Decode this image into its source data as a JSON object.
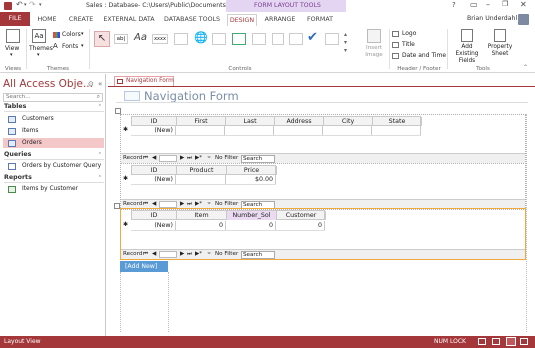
{
  "window": {
    "title": "Sales : Database- C:\\Users\\Public\\Documents\\Sa...",
    "context_tab_group": "FORM LAYOUT TOOLS",
    "help": "?",
    "user": "Brian Underdahl"
  },
  "ribbon_tabs": [
    "FILE",
    "HOME",
    "CREATE",
    "EXTERNAL DATA",
    "DATABASE TOOLS",
    "DESIGN",
    "ARRANGE",
    "FORMAT"
  ],
  "ribbon": {
    "view_label": "View",
    "themes_label": "Themes",
    "colors_label": "Colors",
    "fonts_label": "Fonts",
    "insert_image_label": "Insert Image",
    "logo_label": "Logo",
    "title_label": "Title",
    "date_time_label": "Date and Time",
    "add_existing_fields_label": "Add Existing Fields",
    "property_sheet_label": "Property Sheet",
    "groups": {
      "views": "Views",
      "themes": "Themes",
      "controls": "Controls",
      "header_footer": "Header / Footer",
      "tools": "Tools"
    },
    "colors": {
      "accent": "#a4373a",
      "design_tab": "#a4373a"
    }
  },
  "navpane": {
    "title": "All Access Obje...",
    "search_placeholder": "Search...",
    "sections": [
      {
        "label": "Tables",
        "items": [
          "Customers",
          "Items",
          "Orders"
        ]
      },
      {
        "label": "Queries",
        "items": [
          "Orders by Customer Query"
        ]
      },
      {
        "label": "Reports",
        "items": [
          "Items by Customer"
        ]
      }
    ],
    "selected": "Orders"
  },
  "document": {
    "tab_label": "Navigation Form",
    "form_title": "Navigation Form"
  },
  "subform1": {
    "columns": [
      "ID",
      "First",
      "Last",
      "Address",
      "City",
      "State"
    ],
    "row": [
      "(New)",
      "",
      "",
      "",
      "",
      ""
    ]
  },
  "subform2": {
    "columns": [
      "ID",
      "Product",
      "Price"
    ],
    "row": [
      "(New)",
      "",
      "$0.00"
    ]
  },
  "subform3": {
    "columns": [
      "ID",
      "Item",
      "Number_Sol",
      "Customer"
    ],
    "row": [
      "(New)",
      "0",
      "0",
      "0"
    ]
  },
  "record_nav": {
    "record_label": "Record:",
    "nav_glyphs": [
      "⏮",
      "◀",
      "▶",
      "⏭",
      "▶*"
    ],
    "filter_label": "No Filter",
    "search_label": "Search"
  },
  "add_new_label": "[Add New]",
  "status": {
    "left": "Layout View",
    "num_lock": "NUM LOCK"
  }
}
